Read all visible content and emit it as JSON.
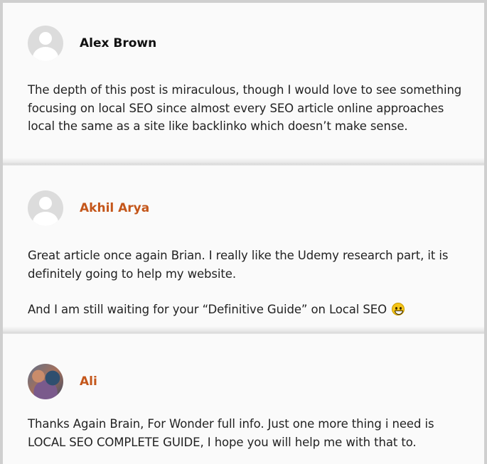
{
  "comments": [
    {
      "author": "Alex Brown",
      "author_is_link": false,
      "avatar": "default-avatar",
      "paragraphs": [
        "The depth of this post is miraculous, though I would love to see something focusing on local SEO since almost every SEO article online approaches local the same as a site like backlinko which doesn’t make sense."
      ]
    },
    {
      "author": "Akhil Arya",
      "author_is_link": true,
      "avatar": "default-avatar",
      "paragraphs": [
        "Great article once again Brian. I really like the Udemy research part, it is definitely going to help my website.",
        "And I am still waiting for your “Definitive Guide” on Local SEO"
      ],
      "emoji": "grinning-face-emoji"
    },
    {
      "author": "Ali",
      "author_is_link": true,
      "avatar": "photo-avatar",
      "paragraphs": [
        "Thanks Again Brain, For Wonder full info. Just one more thing i need is LOCAL SEO COMPLETE GUIDE, I hope you will help me with that to."
      ]
    }
  ],
  "colors": {
    "author_link": "#c4561a",
    "author_plain": "#111111",
    "body_text": "#222222",
    "background": "#fafafa"
  }
}
